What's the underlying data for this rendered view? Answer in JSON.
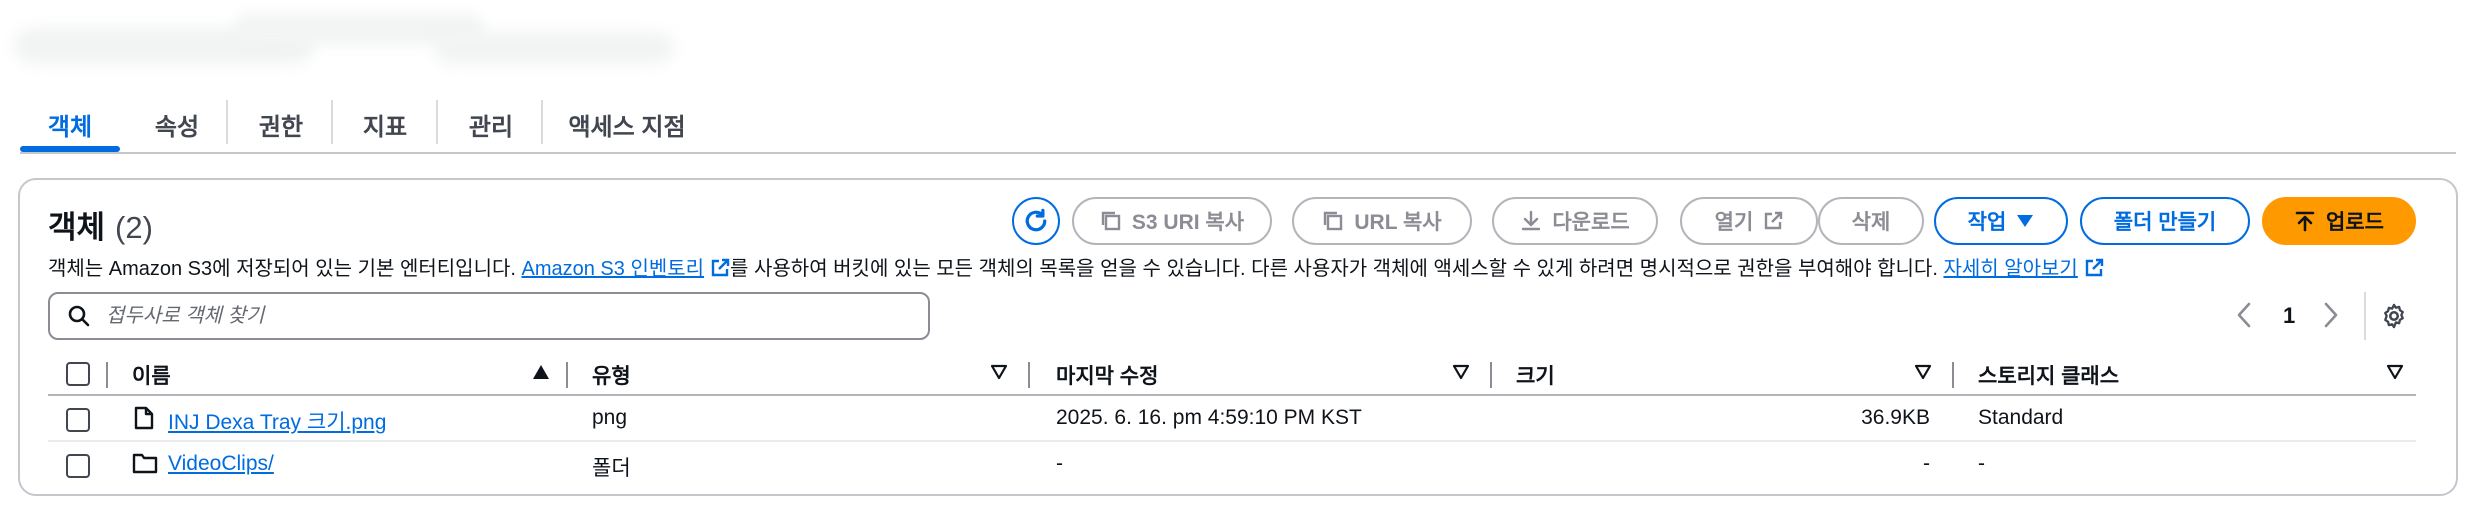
{
  "tabs": [
    {
      "label": "객체",
      "active": true
    },
    {
      "label": "속성"
    },
    {
      "label": "권한"
    },
    {
      "label": "지표"
    },
    {
      "label": "관리"
    },
    {
      "label": "액세스 지점"
    }
  ],
  "objects": {
    "title": "객체",
    "count": "(2)",
    "actions": {
      "refresh_icon": "refresh-icon",
      "copy_s3_uri": "S3 URI 복사",
      "copy_url": "URL 복사",
      "download": "다운로드",
      "open": "열기",
      "delete": "삭제",
      "actions": "작업",
      "create_folder": "폴더 만들기",
      "upload": "업로드"
    },
    "description": {
      "part1": "객체는 Amazon S3에 저장되어 있는 기본 엔터티입니다. ",
      "inventory_link": "Amazon S3 인벤토리",
      "part2": "를 사용하여 버킷에 있는 모든 객체의 목록을 얻을 수 있습니다. 다른 사용자가 객체에 액세스할 수 있게 하려면 명시적으로 권한을 부여해야 합니다. ",
      "learn_more_link": "자세히 알아보기"
    },
    "search": {
      "placeholder": "접두사로 객체 찾기",
      "value": ""
    },
    "pagination": {
      "current_page": "1"
    },
    "columns": [
      "이름",
      "유형",
      "마지막 수정",
      "크기",
      "스토리지 클래스"
    ],
    "sort": {
      "column": "이름",
      "direction": "ascending"
    },
    "rows": [
      {
        "name": "INJ Dexa Tray 크기.png",
        "icon": "file-icon",
        "type": "png",
        "last_modified": "2025. 6. 16. pm 4:59:10 PM KST",
        "size": "36.9KB",
        "storage_class": "Standard"
      },
      {
        "name": "VideoClips/",
        "icon": "folder-icon",
        "type": "폴더",
        "last_modified": "-",
        "size": "-",
        "storage_class": "-"
      }
    ]
  },
  "colors": {
    "accent": "#006ce0",
    "primary_button": "#ff9900",
    "text": "#0f141a",
    "border": "#c6c6cd",
    "disabled": "#8c8c94"
  }
}
